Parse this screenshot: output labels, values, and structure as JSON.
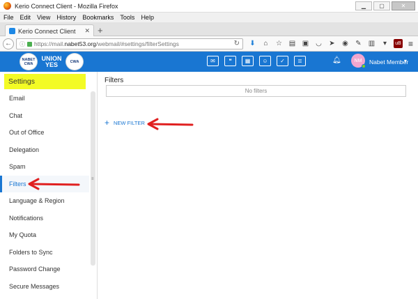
{
  "browser": {
    "window_title": "Kerio Connect Client - Mozilla Firefox",
    "menu": [
      "File",
      "Edit",
      "View",
      "History",
      "Bookmarks",
      "Tools",
      "Help"
    ],
    "tab_title": "Kerio Connect Client",
    "url_prefix": "https://mail.",
    "url_domain": "nabet53.org",
    "url_path": "/webmail/#settings/filterSettings",
    "addon_badge": "uB"
  },
  "header": {
    "logos": [
      "NABET CWA",
      "UNION YES",
      "CWA"
    ],
    "avatar_initials": "NM",
    "user_name": "Nabet Member"
  },
  "sidebar": {
    "title": "Settings",
    "items": [
      {
        "label": "Email"
      },
      {
        "label": "Chat"
      },
      {
        "label": "Out of Office"
      },
      {
        "label": "Delegation"
      },
      {
        "label": "Spam"
      },
      {
        "label": "Filters"
      },
      {
        "label": "Language & Region"
      },
      {
        "label": "Notifications"
      },
      {
        "label": "My Quota"
      },
      {
        "label": "Folders to Sync"
      },
      {
        "label": "Password Change"
      },
      {
        "label": "Secure Messages"
      }
    ],
    "active_item": "Filters"
  },
  "main": {
    "title": "Filters",
    "empty_text": "No filters",
    "new_filter_label": "NEW FILTER"
  },
  "colors": {
    "brand": "#1976d2",
    "highlight": "#f3fb25",
    "annotation_arrow": "#e02020"
  }
}
